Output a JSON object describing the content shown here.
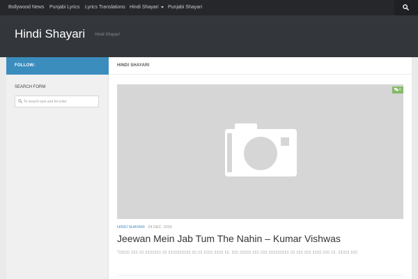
{
  "topnav": {
    "items": [
      {
        "label": "Bollywood News"
      },
      {
        "label": "Punjabi Lyrics"
      },
      {
        "label": "Lyrics Translations"
      },
      {
        "label": "Hindi Shayari"
      },
      {
        "label": "Punjabi Shayari"
      }
    ],
    "search_icon": "search-icon"
  },
  "header": {
    "title": "Hindi Shayari",
    "description": "Hindi Shayari"
  },
  "sidebar": {
    "follow_label": "FOLLOW:",
    "search_title": "SEARCH FORM",
    "search_placeholder": "To search type and hit enter"
  },
  "main": {
    "page_title": "HINDI SHAYARI",
    "post": {
      "comment_count": "0",
      "category": "HINDI SHAYARI",
      "date": "24 DEC, 2015",
      "title": "Jeewan Mein Jab Tum The Nahin – Kumar Vishwas",
      "excerpt": "\"▯▯▯▯▯ ▯▯▯ ▯▯ ▯▯▯▯▯▯▯ ▯▯ ▯▯▯▯▯▯▯▯▯▯ ▯▯ ▯▯ ▯▯▯▯ ▯▯▯▯ ▯▯, ▯▯▯ ▯▯▯▯▯ ▯▯▯ ▯▯▯ ▯▯▯▯▯▯▯▯▯ ▯▯ ▯▯▯ ▯▯▯ ▯▯▯▯ ▯▯▯ ▯▯, ▯▯▯▯▯ ▯▯▯"
    }
  },
  "colors": {
    "topnav_bg": "#26272b",
    "header_bg": "#33363b",
    "accent_blue": "#3b8dbd",
    "comment_green": "#82b965"
  }
}
